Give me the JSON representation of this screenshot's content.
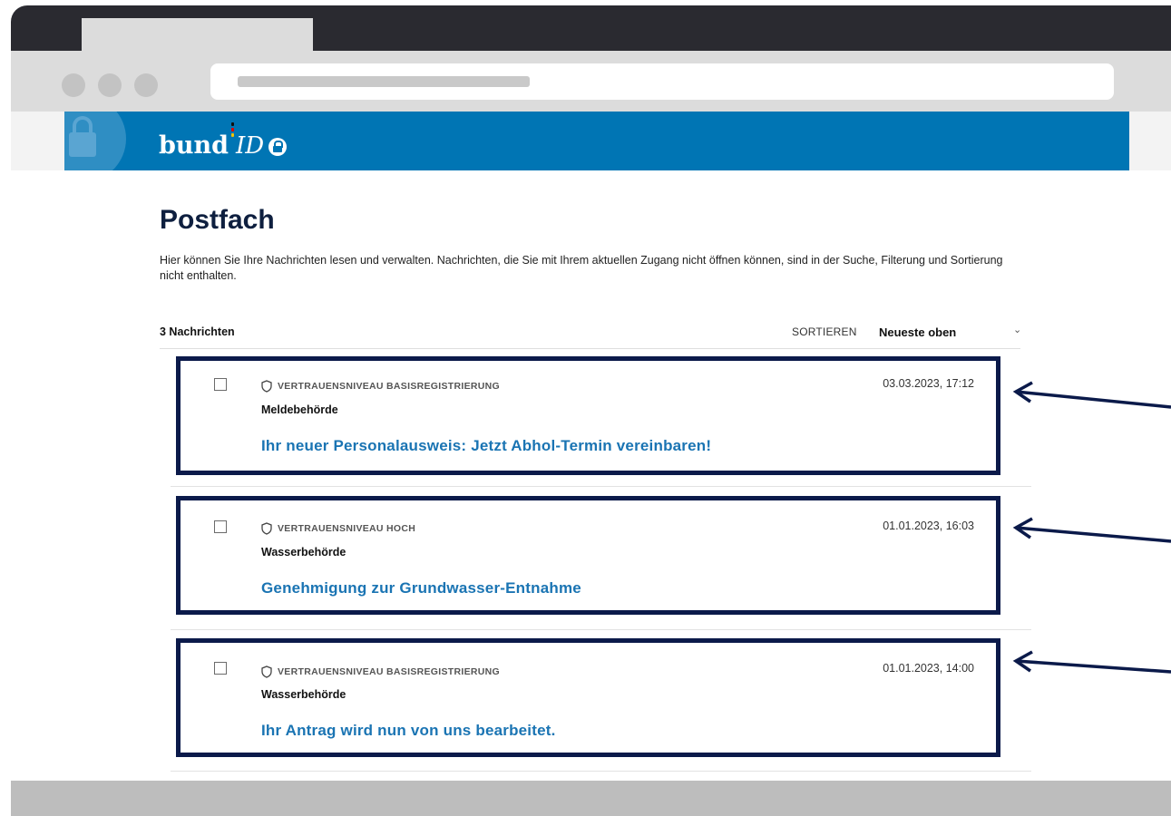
{
  "brand": {
    "name_part1": "bund",
    "name_part2": "ID"
  },
  "page": {
    "title": "Postfach",
    "intro": "Hier können Sie Ihre Nachrichten lesen und verwalten. Nachrichten, die Sie mit Ihrem aktuellen Zugang nicht öffnen können, sind in der Suche, Filterung und Sortierung nicht enthalten."
  },
  "list": {
    "count_label": "3 Nachrichten",
    "sort_label": "SORTIEREN",
    "sort_value": "Neueste oben"
  },
  "messages": [
    {
      "trust_level": "VERTRAUENSNIVEAU BASISREGISTRIERUNG",
      "sender": "Meldebehörde",
      "subject": "Ihr neuer Personalausweis: Jetzt Abhol-Termin vereinbaren!",
      "date": "03.03.2023, 17:12"
    },
    {
      "trust_level": "VERTRAUENSNIVEAU HOCH",
      "sender": "Wasserbehörde",
      "subject": "Genehmigung zur Grundwasser-Entnahme",
      "date": "01.01.2023, 16:03"
    },
    {
      "trust_level": "VERTRAUENSNIVEAU BASISREGISTRIERUNG",
      "sender": "Wasserbehörde",
      "subject": "Ihr Antrag wird nun von uns bearbeitet.",
      "date": "01.01.2023, 14:00"
    }
  ],
  "colors": {
    "header_blue": "#0075b4",
    "subject_blue": "#1a74b3",
    "highlight_border": "#0b1a4a"
  },
  "icons": {
    "trust": "shield-icon",
    "sort": "chevron-down-icon",
    "brand_lock": "lock-icon"
  }
}
